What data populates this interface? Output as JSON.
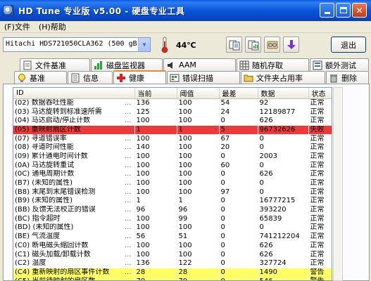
{
  "window": {
    "title": "HD Tune 专业版 v5.00 - 硬盘专业工具"
  },
  "menu": {
    "items": [
      "(F)文件",
      "(H)帮助"
    ]
  },
  "toolbar": {
    "drive": "Hitachi HDS721050CLA362 (500 gB)",
    "temperature": "44℃",
    "exit_label": "退出",
    "buttons": [
      "copy-text-icon",
      "copy-screenshot-icon",
      "settings-icon",
      "download-arrow-icon"
    ]
  },
  "tabs_row1": [
    "文件基准",
    "磁盘监视器",
    "AAM",
    "随机存取",
    "额外测试"
  ],
  "tabs_row2": [
    "基准",
    "信息",
    "健康",
    "错误扫描",
    "文件夹占用率",
    "删除"
  ],
  "table": {
    "columns": [
      "ID",
      "当前",
      "阈值",
      "最差",
      "数据",
      "状态"
    ],
    "rows": [
      {
        "id": "(02) 数据吞吐性能",
        "dots": "...",
        "current": "136",
        "threshold": "100",
        "worst": "54",
        "data": "92",
        "status": "正常",
        "hl": ""
      },
      {
        "id": "(03) 马达旋转到标准速所需",
        "dots": "...",
        "current": "125",
        "threshold": "100",
        "worst": "24",
        "data": "12189877",
        "status": "正常",
        "hl": ""
      },
      {
        "id": "(04) 马达启动/停止计数",
        "dots": "...",
        "current": "100",
        "threshold": "100",
        "worst": "0",
        "data": "626",
        "status": "正常",
        "hl": ""
      },
      {
        "id": "(05) 重映射扇区计数",
        "dots": "...",
        "current": "1",
        "threshold": "1",
        "worst": "5",
        "data": "96732626",
        "status": "失败",
        "hl": "red"
      },
      {
        "id": "(07) 寻道错误率",
        "dots": "...",
        "current": "100",
        "threshold": "100",
        "worst": "67",
        "data": "0",
        "status": "正常",
        "hl": ""
      },
      {
        "id": "(08) 寻道时间性能",
        "dots": "...",
        "current": "140",
        "threshold": "100",
        "worst": "20",
        "data": "0",
        "status": "正常",
        "hl": ""
      },
      {
        "id": "(09) 累计通电时间计数",
        "dots": "...",
        "current": "100",
        "threshold": "100",
        "worst": "0",
        "data": "2003",
        "status": "正常",
        "hl": ""
      },
      {
        "id": "(0A) 马达旋转重试",
        "dots": "...",
        "current": "100",
        "threshold": "100",
        "worst": "60",
        "data": "0",
        "status": "正常",
        "hl": ""
      },
      {
        "id": "(0C) 通电周期计数",
        "dots": "...",
        "current": "100",
        "threshold": "100",
        "worst": "0",
        "data": "626",
        "status": "正常",
        "hl": ""
      },
      {
        "id": "(B7) (未知的属性)",
        "dots": "...",
        "current": "100",
        "threshold": "100",
        "worst": "0",
        "data": "0",
        "status": "正常",
        "hl": ""
      },
      {
        "id": "(B8) 末尾到末尾错误检测",
        "dots": "...",
        "current": "100",
        "threshold": "100",
        "worst": "97",
        "data": "0",
        "status": "正常",
        "hl": ""
      },
      {
        "id": "(B9) (未知的属性)",
        "dots": "...",
        "current": "1",
        "threshold": "1",
        "worst": "0",
        "data": "16777215",
        "status": "正常",
        "hl": ""
      },
      {
        "id": "(BB) 反馈无法校正的错误",
        "dots": "...",
        "current": "96",
        "threshold": "96",
        "worst": "0",
        "data": "393220",
        "status": "正常",
        "hl": ""
      },
      {
        "id": "(BC) 指令超时",
        "dots": "...",
        "current": "100",
        "threshold": "99",
        "worst": "0",
        "data": "65839",
        "status": "正常",
        "hl": ""
      },
      {
        "id": "(BD) (未知的属性)",
        "dots": "...",
        "current": "100",
        "threshold": "100",
        "worst": "0",
        "data": "0",
        "status": "正常",
        "hl": ""
      },
      {
        "id": "(BE) 气流温度",
        "dots": "...",
        "current": "56",
        "threshold": "51",
        "worst": "0",
        "data": "741212204",
        "status": "正常",
        "hl": ""
      },
      {
        "id": "(C0) 断电磁头缩回计数",
        "dots": "...",
        "current": "100",
        "threshold": "100",
        "worst": "0",
        "data": "626",
        "status": "正常",
        "hl": ""
      },
      {
        "id": "(C1) 磁头加载/卸载计数",
        "dots": "...",
        "current": "100",
        "threshold": "100",
        "worst": "0",
        "data": "626",
        "status": "正常",
        "hl": ""
      },
      {
        "id": "(C2) 温度",
        "dots": "...",
        "current": "136",
        "threshold": "122",
        "worst": "0",
        "data": "327724",
        "status": "正常",
        "hl": ""
      },
      {
        "id": "(C4) 重新映射的扇区事件计数",
        "dots": "...",
        "current": "28",
        "threshold": "28",
        "worst": "0",
        "data": "1490",
        "status": "警告",
        "hl": "yellow"
      },
      {
        "id": "(C5) 当前待映射的扇区数",
        "dots": "...",
        "current": "79",
        "threshold": "79",
        "worst": "0",
        "data": "546",
        "status": "警告",
        "hl": "yellow"
      },
      {
        "id": "(C6) 脱机无法校正的扇区数",
        "dots": "...",
        "current": "100",
        "threshold": "100",
        "worst": "0",
        "data": "0",
        "status": "正常",
        "hl": ""
      }
    ]
  }
}
